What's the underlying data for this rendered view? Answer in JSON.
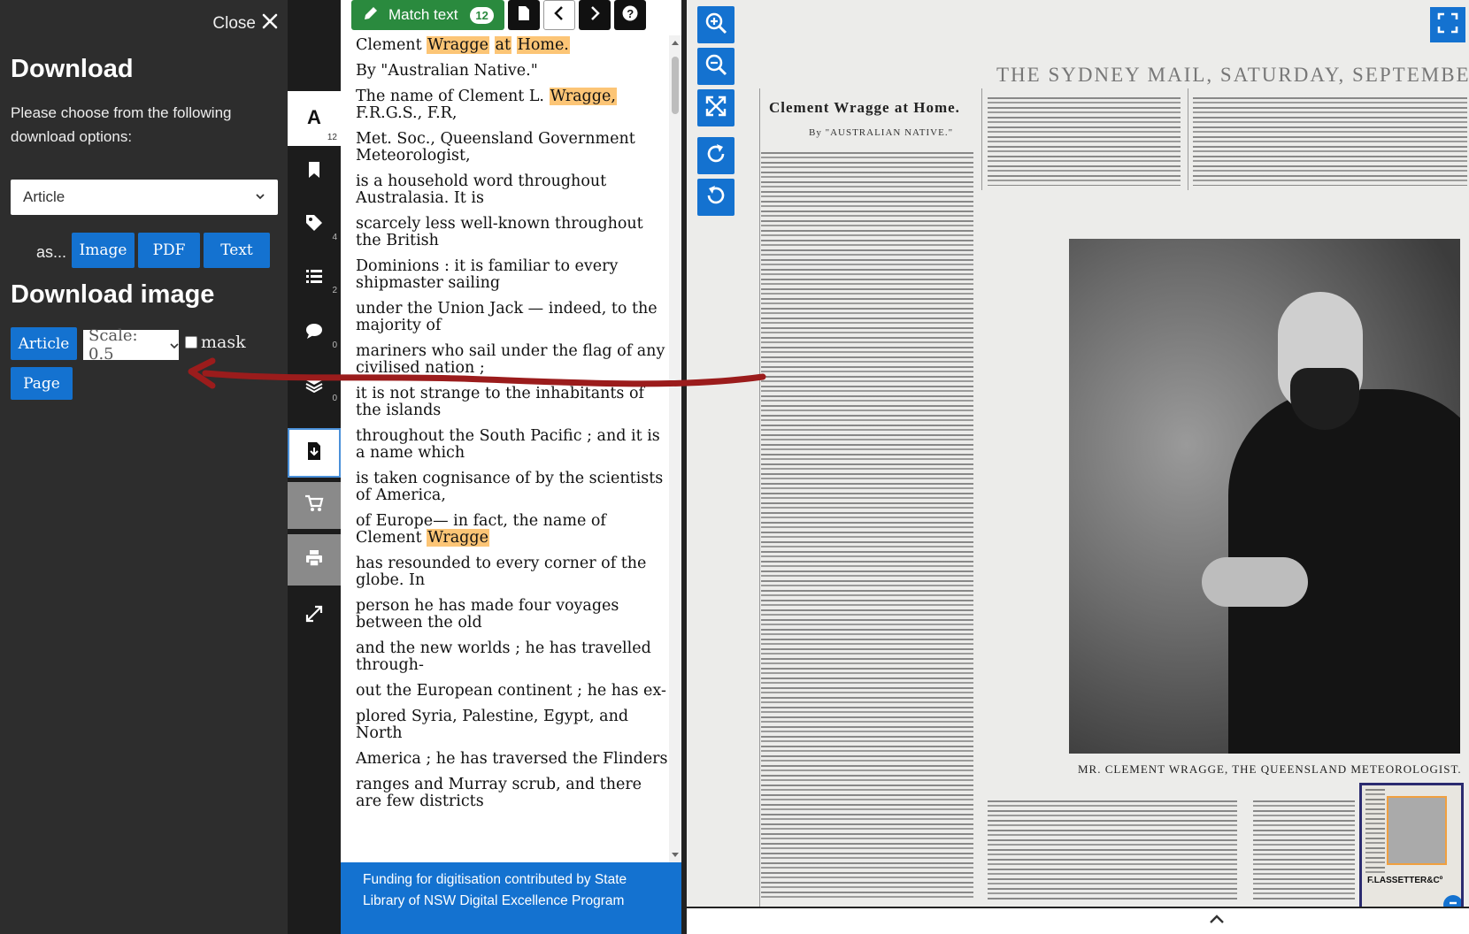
{
  "download_panel": {
    "close_label": "Close",
    "heading": "Download",
    "description": "Please choose from the following download options:",
    "format_select": {
      "value": "Article"
    },
    "as_label": "as...",
    "formats": [
      "Image",
      "PDF",
      "Text"
    ],
    "image_heading": "Download image",
    "article_button": "Article",
    "scale_select": {
      "value": "Scale: 0.5"
    },
    "mask_label": "mask",
    "page_button": "Page"
  },
  "toolbar": {
    "text_count": "12",
    "tags_count": "4",
    "lists_count": "2",
    "comments_count": "0",
    "versions_count": "0"
  },
  "text_toolbar": {
    "match_label": "Match text",
    "match_count": "12"
  },
  "ocr_lines": [
    [
      "Clement ",
      {
        "hl": "Wragge"
      },
      " ",
      {
        "hl": "at"
      },
      " ",
      {
        "hl": "Home."
      }
    ],
    [
      "By \"Australian Native.\""
    ],
    [
      "The name of Clement L. ",
      {
        "hl": "Wragge,"
      },
      " F.R.G.S., F.R,"
    ],
    [
      "Met. Soc., Queensland Government Meteorologist,"
    ],
    [
      "is a household word throughout Australasia. It is"
    ],
    [
      "scarcely less well-known throughout the British"
    ],
    [
      "Dominions : it is familiar to every shipmaster sailing"
    ],
    [
      "under the Union Jack — indeed, to the majority of"
    ],
    [
      "mariners who sail under the flag of any civilised nation ;"
    ],
    [
      "it is not strange to the inhabitants of the islands"
    ],
    [
      "throughout the South Pacific ; and it is a name which"
    ],
    [
      "is taken cognisance of by the scientists of America,"
    ],
    [
      "of Europe— in fact, the name of Clement ",
      {
        "hl": "Wragge"
      }
    ],
    [
      "has resounded to every corner of the globe. In"
    ],
    [
      "person he has made four voyages between the old"
    ],
    [
      "and the new worlds ; he has travelled through-"
    ],
    [
      "out the European continent ; he has ex-"
    ],
    [
      "plored Syria, Palestine, Egypt, and North"
    ],
    [
      "America ; he has traversed the Flinders"
    ],
    [
      "ranges and Murray scrub, and there are few districts"
    ]
  ],
  "funding_text": "Funding for digitisation contributed by State Library of NSW Digital Excellence Program",
  "newspaper": {
    "masthead": "THE SYDNEY MAIL, SATURDAY, SEPTEMBER",
    "article_title": "Clement Wragge at Home.",
    "byline": "By \"AUSTRALIAN NATIVE.\"",
    "caption": "MR. CLEMENT WRAGGE, THE QUEENSLAND METEOROLOGIST.",
    "thumbnail_label": "F.LASSETTER&Cº"
  },
  "colors": {
    "accent_blue": "#1472d0",
    "match_green": "#2a8a3e",
    "highlight": "#fcc576",
    "annotation_red": "#9b1c1c"
  }
}
